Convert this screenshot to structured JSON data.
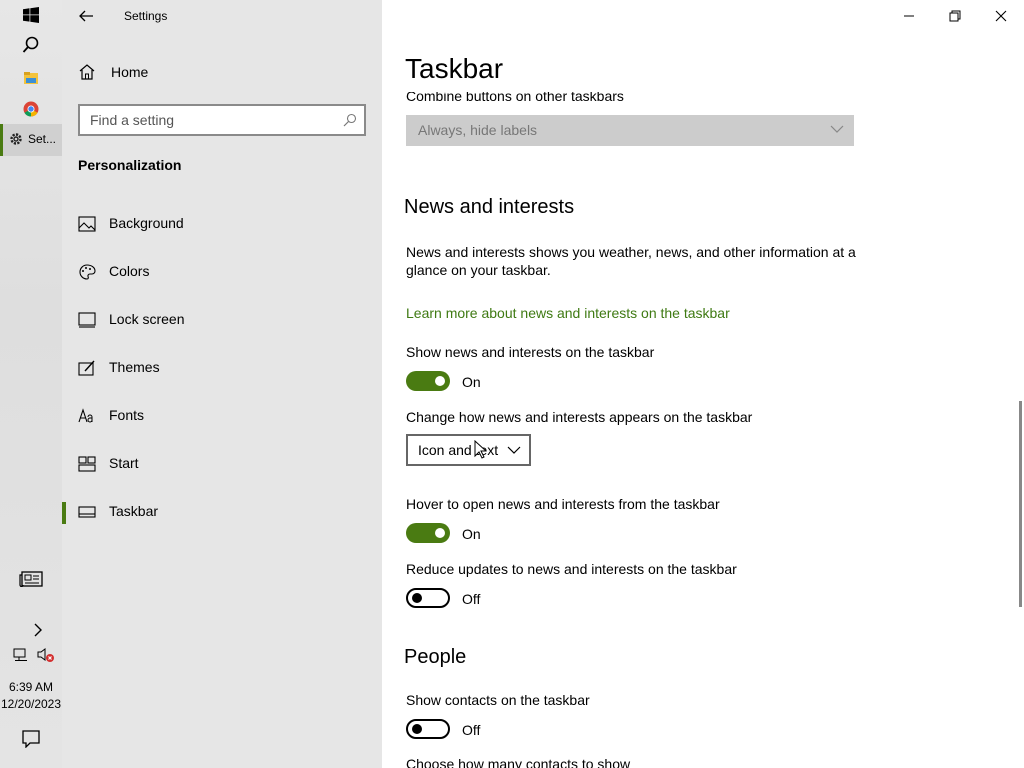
{
  "taskbar": {
    "active_app_label": "Set...",
    "time": "6:39 AM",
    "date": "12/20/2023",
    "icons": [
      "windows-logo-icon",
      "search-icon",
      "file-explorer-icon",
      "chrome-icon",
      "settings-gear-icon",
      "news-icon",
      "chevron-right-icon",
      "network-icon",
      "volume-muted-icon",
      "action-center-icon"
    ]
  },
  "window": {
    "title": "Settings"
  },
  "nav": {
    "home_label": "Home",
    "search_placeholder": "Find a setting",
    "section_header": "Personalization",
    "items": [
      {
        "label": "Background",
        "icon": "image-icon"
      },
      {
        "label": "Colors",
        "icon": "palette-icon"
      },
      {
        "label": "Lock screen",
        "icon": "lock-screen-icon"
      },
      {
        "label": "Themes",
        "icon": "themes-icon"
      },
      {
        "label": "Fonts",
        "icon": "fonts-icon"
      },
      {
        "label": "Start",
        "icon": "start-icon"
      },
      {
        "label": "Taskbar",
        "icon": "taskbar-icon",
        "selected": true
      }
    ]
  },
  "content": {
    "page_title": "Taskbar",
    "combine_label": "Combine buttons on other taskbars",
    "combine_value": "Always, hide labels",
    "news": {
      "heading": "News and interests",
      "description": "News and interests shows you weather, news, and other information at a glance on your taskbar.",
      "learn_more": "Learn more about news and interests on the taskbar",
      "show_label": "Show news and interests on the taskbar",
      "show_state": "On",
      "appearance_label": "Change how news and interests appears on the taskbar",
      "appearance_value": "Icon and text",
      "hover_label": "Hover to open news and interests from the taskbar",
      "hover_state": "On",
      "reduce_label": "Reduce updates to news and interests on the taskbar",
      "reduce_state": "Off"
    },
    "people": {
      "heading": "People",
      "show_contacts_label": "Show contacts on the taskbar",
      "show_contacts_state": "Off",
      "contacts_count_label": "Choose how many contacts to show"
    }
  },
  "colors": {
    "accent": "#4a7b12",
    "link": "#3f7a13"
  }
}
